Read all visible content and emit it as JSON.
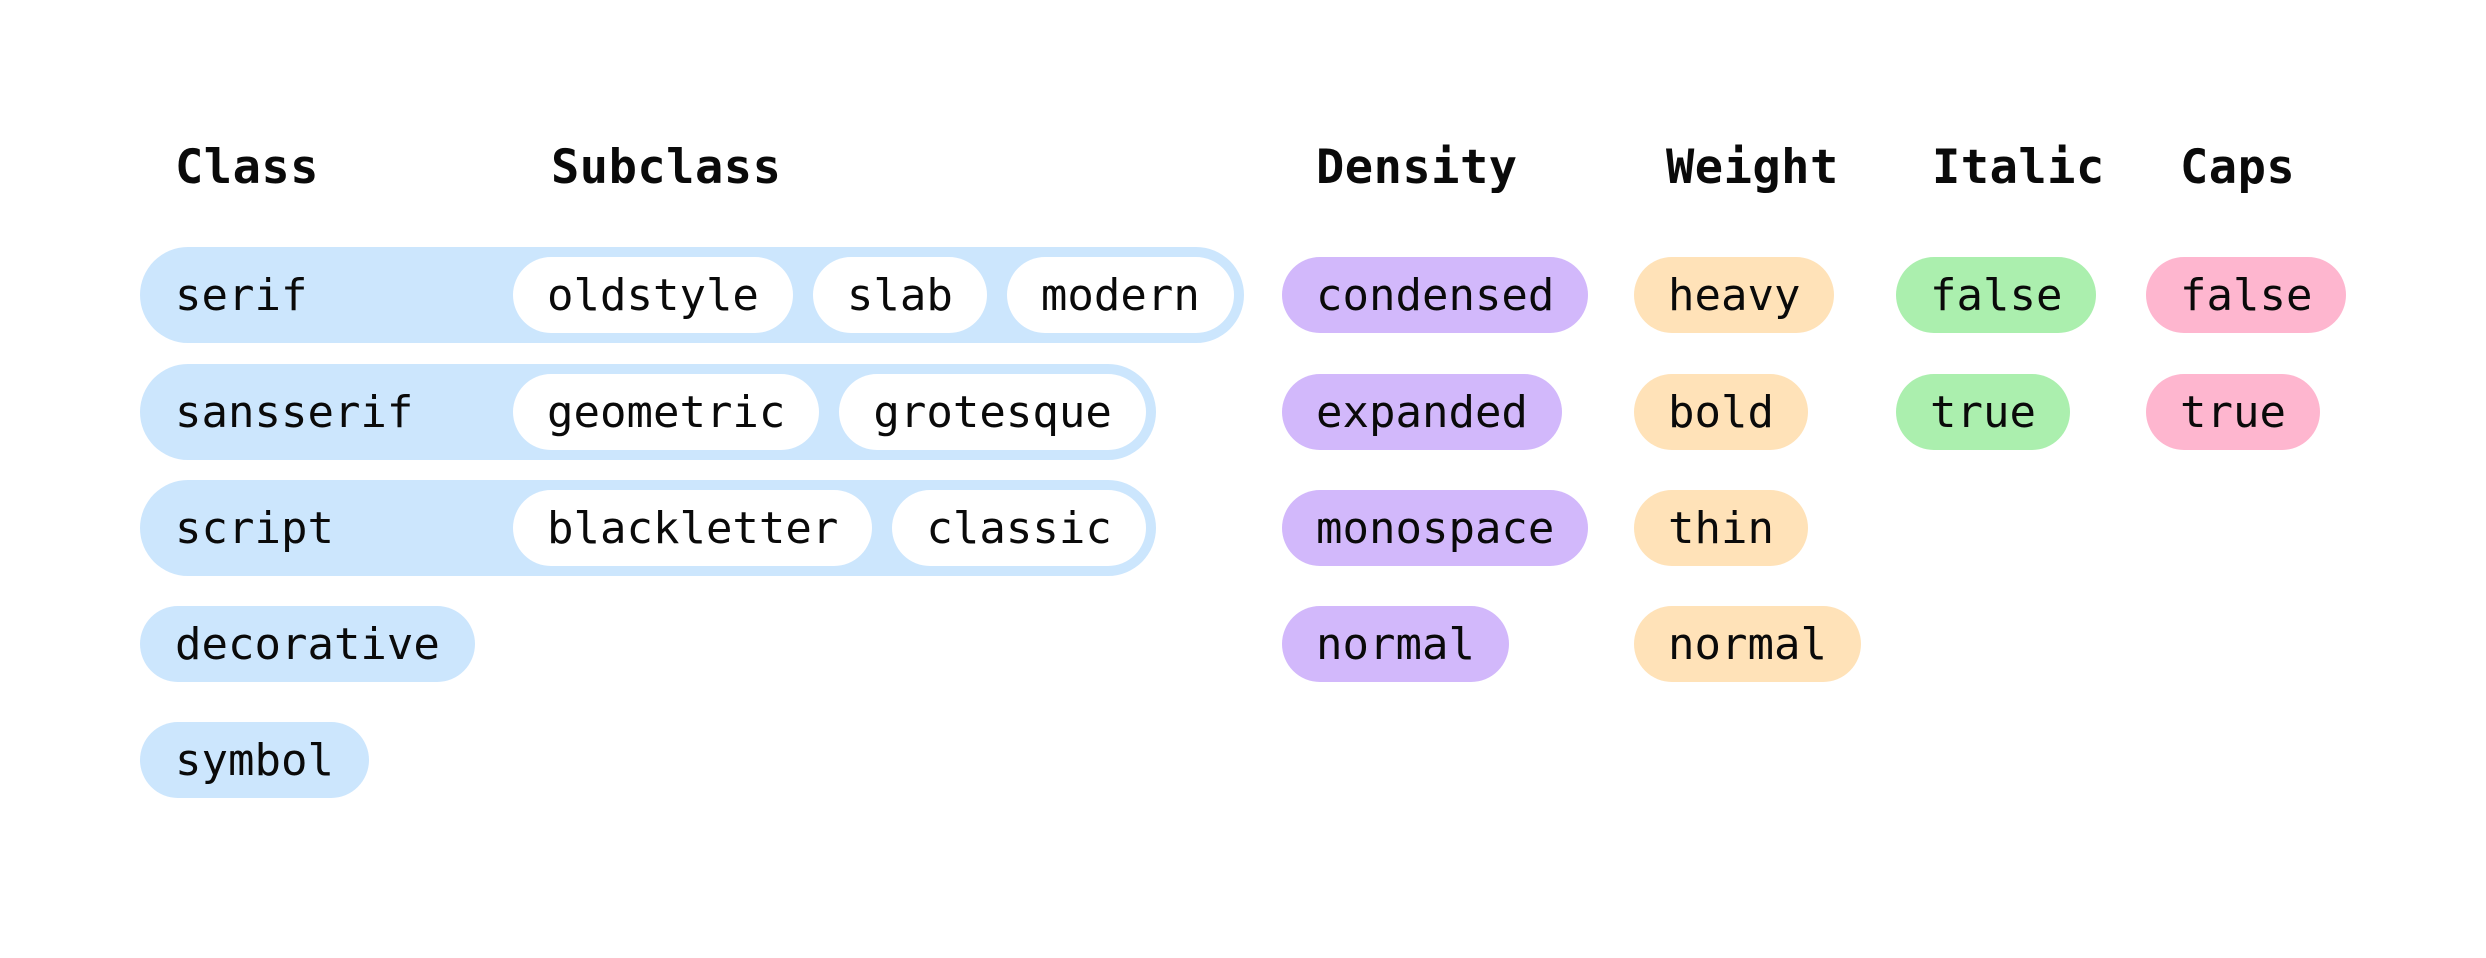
{
  "headers": {
    "class": "Class",
    "subclass": "Subclass",
    "density": "Density",
    "weight": "Weight",
    "italic": "Italic",
    "caps": "Caps"
  },
  "colors": {
    "class": "#cce6fd",
    "subclass": "#ffffff",
    "density": "#d2b8fb",
    "weight": "#ffe2b8",
    "italic": "#abefae",
    "caps": "#feb6cf"
  },
  "classes": [
    {
      "label": "serif",
      "subclasses": [
        "oldstyle",
        "slab",
        "modern"
      ]
    },
    {
      "label": "sansserif",
      "subclasses": [
        "geometric",
        "grotesque"
      ]
    },
    {
      "label": "script",
      "subclasses": [
        "blackletter",
        "classic"
      ]
    },
    {
      "label": "decorative",
      "subclasses": []
    },
    {
      "label": "symbol",
      "subclasses": []
    }
  ],
  "density": [
    "condensed",
    "expanded",
    "monospace",
    "normal"
  ],
  "weight": [
    "heavy",
    "bold",
    "thin",
    "normal"
  ],
  "italic": [
    "false",
    "true"
  ],
  "caps": [
    "false",
    "true"
  ]
}
